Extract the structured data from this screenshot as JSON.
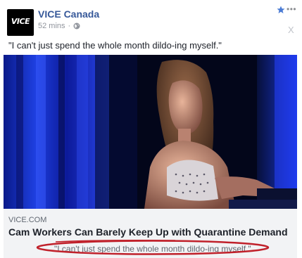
{
  "post": {
    "page_name": "VICE Canada",
    "avatar_text": "VICE",
    "timestamp": "52 mins",
    "separator": "·",
    "more_label": "•••",
    "close_label": "X",
    "text": "\"I can't just spend the whole month dildo-ing myself.\""
  },
  "link_preview": {
    "domain": "VICE.COM",
    "headline": "Cam Workers Can Barely Keep Up with Quarantine Demand",
    "description": "\"I can't just spend the whole month dildo-ing myself.\""
  },
  "colors": {
    "page_name": "#365899",
    "annotation_circle": "#c0212b",
    "star": "#4a7bd4"
  },
  "icons": [
    "globe-icon",
    "star-icon",
    "more-icon",
    "close-icon"
  ]
}
